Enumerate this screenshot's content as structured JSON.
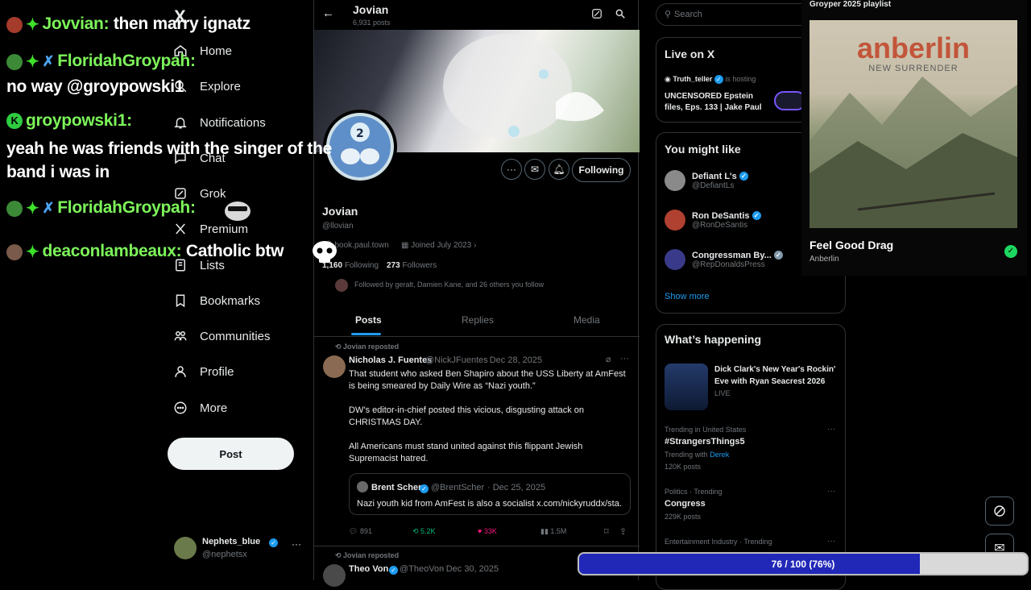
{
  "colors": {
    "accent": "#1d9bf0",
    "chat_name": "#7cf55a",
    "progress": "#2128b8",
    "like": "#f91880",
    "repost": "#00ba7c"
  },
  "chat": [
    {
      "user": "Jovvian:",
      "text": "then marry ignatz"
    },
    {
      "user": "FloridahGroypah:",
      "text": "no way @groypowski1"
    },
    {
      "user": "groypowski1:",
      "text": "yeah he was friends with the singer of the band i was in"
    },
    {
      "user": "FloridahGroypah:",
      "text": ""
    },
    {
      "user": "deaconlambeaux:",
      "text": "Catholic btw"
    }
  ],
  "nav": {
    "logo": "X",
    "items": [
      "Home",
      "Explore",
      "Notifications",
      "Chat",
      "Grok",
      "Premium",
      "Lists",
      "Bookmarks",
      "Communities",
      "Profile",
      "More"
    ],
    "post_label": "Post",
    "account": {
      "name": "Nephets_blue",
      "handle": "@nephetsx"
    }
  },
  "profile": {
    "header_name": "Jovian",
    "header_posts": "6,931 posts",
    "name": "Jovian",
    "handle": "@llovian",
    "website": "book.paul.town",
    "joined": "Joined July 2023",
    "following_count": "1,160",
    "following_label": "Following",
    "followers_count": "273",
    "followers_label": "Followers",
    "followed_by": "Followed by geralt, Damien Kane, and 26 others you follow",
    "following_button": "Following",
    "tabs": [
      "Posts",
      "Replies",
      "Media"
    ]
  },
  "tweets": [
    {
      "reposted_by": "Jovian reposted",
      "author": "Nicholas J. Fuentes",
      "handle": "@NickJFuentes",
      "date": "· Dec 28, 2025",
      "paragraphs": [
        "That student who asked Ben Shapiro about the USS Liberty at AmFest is being smeared by Daily Wire as “Nazi youth.”",
        "DW’s editor-in-chief posted this vicious, disgusting attack on CHRISTMAS DAY.",
        "All Americans must stand united against this flippant Jewish Supremacist hatred."
      ],
      "quote": {
        "author": "Brent Scher",
        "handle": "@BrentScher",
        "date": "· Dec 25, 2025",
        "text": "Nazi youth kid from AmFest is also a socialist x.com/nickyruddx/sta..."
      },
      "stats": {
        "replies": "891",
        "reposts": "5.2K",
        "likes": "33K",
        "views": "1.5M"
      }
    },
    {
      "reposted_by": "Jovian reposted",
      "author": "Theo Von",
      "handle": "@TheoVon",
      "date": "· Dec 30, 2025"
    }
  ],
  "search": {
    "placeholder": "Search"
  },
  "live": {
    "title": "Live on X",
    "host": "Truth_teller",
    "hosting": "is hosting",
    "show": "UNCENSORED Epstein files, Eps. 133 | Jake Paul"
  },
  "suggestions": {
    "title": "You might like",
    "people": [
      {
        "name": "Defiant L's",
        "handle": "@DefiantLs"
      },
      {
        "name": "Ron DeSantis",
        "handle": "@RonDeSantis"
      },
      {
        "name": "Congressman By...",
        "handle": "@RepDonaldsPress"
      }
    ],
    "show_more": "Show more"
  },
  "trends": {
    "title": "What’s happening",
    "event": {
      "title": "Dick Clark's New Year's Rockin' Eve with Ryan Seacrest 2026",
      "status": "LIVE"
    },
    "items": [
      {
        "context": "Trending in United States",
        "name": "#StrangersThings5",
        "extra_label": "Trending with",
        "extra_link": "Derek",
        "count": "120K posts"
      },
      {
        "context": "Politics · Trending",
        "name": "Congress",
        "count": "229K posts"
      },
      {
        "context": "Entertainment Industry · Trending"
      }
    ]
  },
  "playlist": {
    "title": "Groyper 2025 playlist",
    "album_artist": "anberlin",
    "album_title": "NEW SURRENDER",
    "track": "Feel Good Drag",
    "artist": "Anberlin"
  },
  "progress": {
    "label": "76 / 100 (76%)",
    "value": 0.76
  }
}
